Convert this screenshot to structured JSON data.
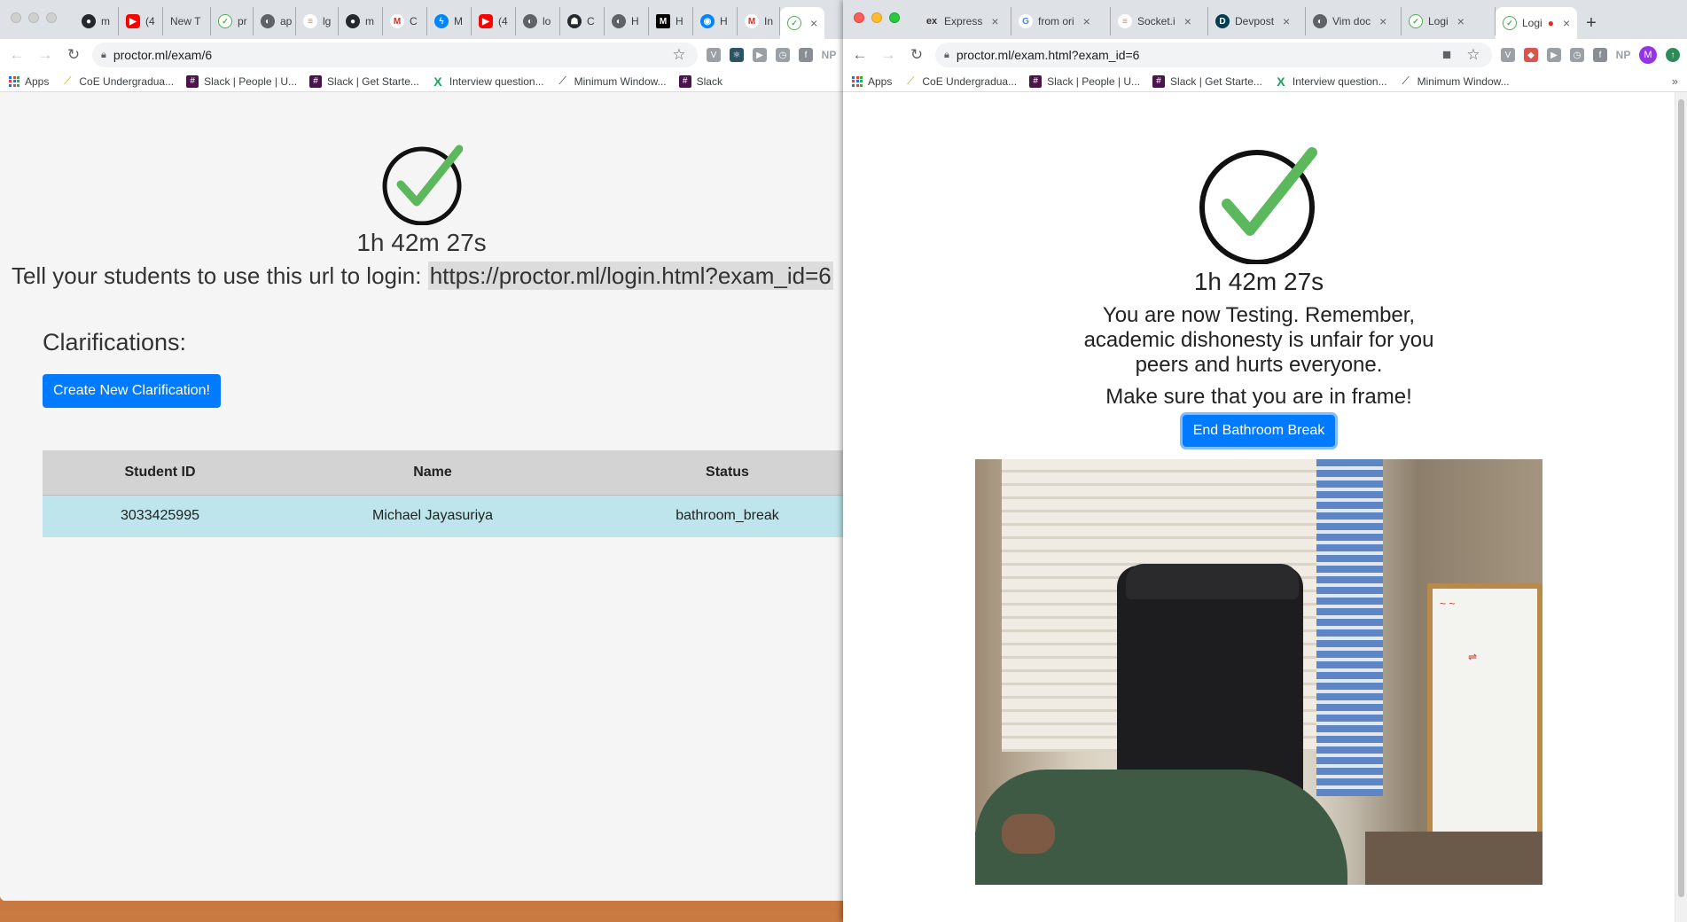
{
  "left_window": {
    "tabs": [
      {
        "icon": "github-icon",
        "glyph": "●",
        "favclass": "github",
        "label": "m"
      },
      {
        "icon": "youtube-icon",
        "glyph": "▶",
        "favclass": "youtube",
        "label": "(4"
      },
      {
        "icon": "",
        "glyph": "",
        "favclass": "",
        "label": "New T"
      },
      {
        "icon": "proctor-icon",
        "glyph": "✓",
        "favclass": "proctor",
        "label": "pr"
      },
      {
        "icon": "generic-site-icon",
        "glyph": "◐",
        "favclass": "generic",
        "label": "ap"
      },
      {
        "icon": "stackoverflow-icon",
        "glyph": "≡",
        "favclass": "stack",
        "label": "lg"
      },
      {
        "icon": "github-icon",
        "glyph": "●",
        "favclass": "github",
        "label": "m"
      },
      {
        "icon": "gmail-icon",
        "glyph": "M",
        "favclass": "gmail",
        "label": "C"
      },
      {
        "icon": "messenger-icon",
        "glyph": "ϟ",
        "favclass": "messenger",
        "label": "M"
      },
      {
        "icon": "youtube-icon",
        "glyph": "▶",
        "favclass": "youtube",
        "label": "(4"
      },
      {
        "icon": "generic-site-icon",
        "glyph": "◐",
        "favclass": "generic",
        "label": "lo"
      },
      {
        "icon": "ghost-icon",
        "glyph": "☗",
        "favclass": "github",
        "label": "C"
      },
      {
        "icon": "generic-site-icon",
        "glyph": "◐",
        "favclass": "generic",
        "label": "H"
      },
      {
        "icon": "medium-icon",
        "glyph": "M",
        "favclass": "medium",
        "label": "H"
      },
      {
        "icon": "eye-icon",
        "glyph": "◉",
        "favclass": "messenger",
        "label": "H"
      },
      {
        "icon": "gmail-icon",
        "glyph": "M",
        "favclass": "gmail",
        "label": "In"
      }
    ],
    "active_tab_close": "×",
    "url": "proctor.ml/exam/6",
    "bookmarks": {
      "apps": "Apps",
      "coe": "CoE Undergradua...",
      "slack_people": "Slack | People | U...",
      "slack_start": "Slack | Get Starte...",
      "interview": "Interview question...",
      "minimum": "Minimum Window...",
      "slack": "Slack"
    },
    "timer": "1h 42m 27s",
    "login_prefix": "Tell your students to use this url to login: ",
    "login_url": "https://proctor.ml/login.html?exam_id=6",
    "clarifications_heading": "Clarifications:",
    "create_button": "Create New Clarification!",
    "table": {
      "headers": [
        "Student ID",
        "Name",
        "Status"
      ],
      "rows": [
        [
          "3033425995",
          "Michael Jayasuriya",
          "bathroom_break"
        ]
      ]
    }
  },
  "right_window": {
    "tabs": [
      {
        "icon": "express-icon",
        "glyph": "ex",
        "favclass": "express",
        "label": "Express"
      },
      {
        "icon": "google-icon",
        "glyph": "G",
        "favclass": "google",
        "label": "from ori"
      },
      {
        "icon": "stackoverflow-icon",
        "glyph": "≡",
        "favclass": "stack",
        "label": "Socket.i"
      },
      {
        "icon": "devpost-icon",
        "glyph": "D",
        "favclass": "devpost",
        "label": "Devpost"
      },
      {
        "icon": "generic-site-icon",
        "glyph": "◐",
        "favclass": "generic",
        "label": "Vim doc"
      },
      {
        "icon": "proctor-icon",
        "glyph": "✓",
        "favclass": "proctor",
        "label": "Logi"
      }
    ],
    "active_tab": {
      "label": "Logi"
    },
    "new_tab": "+",
    "url": "proctor.ml/exam.html?exam_id=6",
    "avatar": "M",
    "bookmarks": {
      "apps": "Apps",
      "coe": "CoE Undergradua...",
      "slack_people": "Slack | People | U...",
      "slack_start": "Slack | Get Starte...",
      "interview": "Interview question...",
      "minimum": "Minimum Window...",
      "more": "»"
    },
    "timer": "1h 42m 27s",
    "notice": "You are now Testing. Remember, academic dishonesty is unfair for you peers and hurts everyone.",
    "frame_message": "Make sure that you are in frame!",
    "end_button": "End Bathroom Break"
  },
  "colors": {
    "accent": "#007bff",
    "check_green": "#5cb85c",
    "table_header": "#d3d3d3",
    "table_row": "#bde5eb"
  }
}
